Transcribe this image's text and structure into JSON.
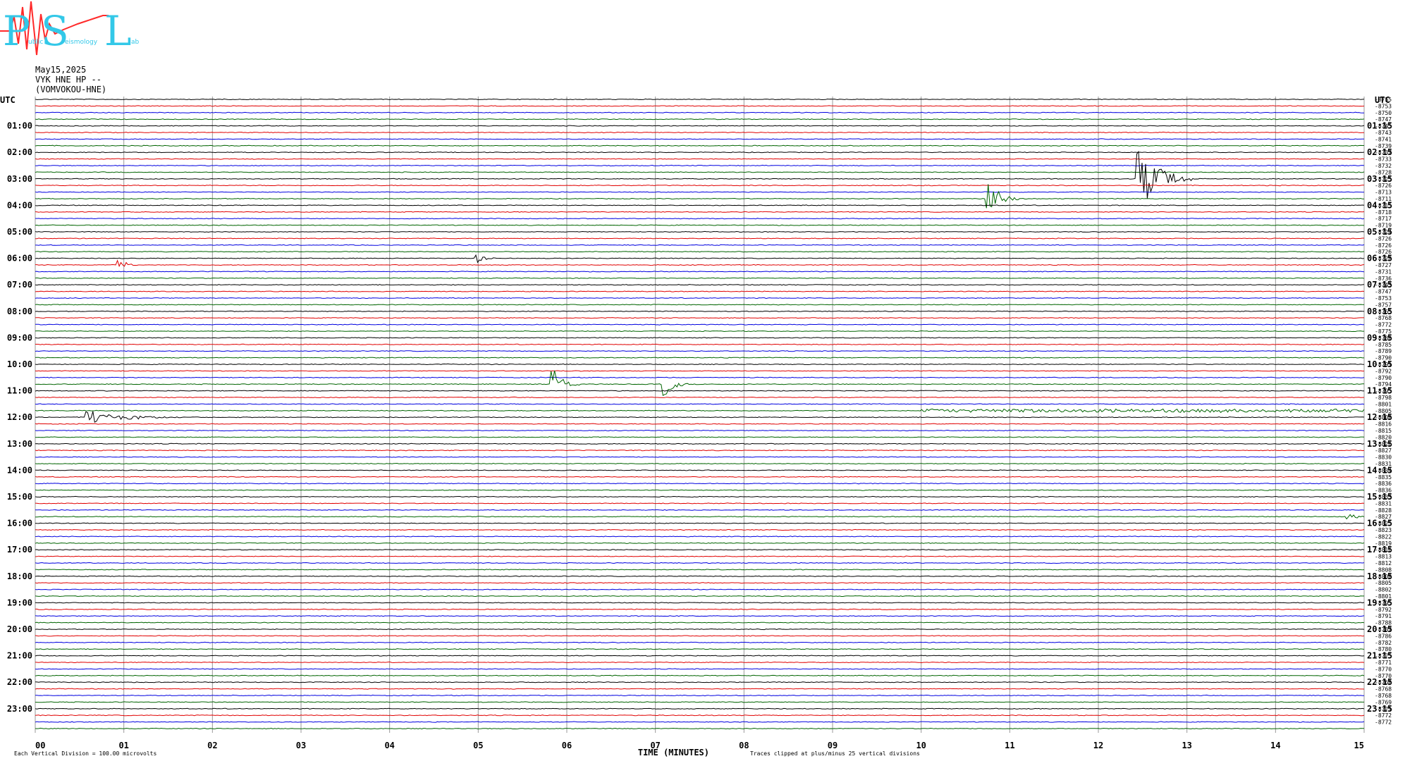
{
  "logo": {
    "letters": [
      "P",
      "S",
      "L"
    ],
    "words": [
      "ublic",
      "eismology",
      "ab"
    ],
    "colors": {
      "main": "#33c8e8",
      "wave": "#ff2a2a"
    }
  },
  "header": {
    "date": "May15,2025",
    "channel": "VYK HNE HP --",
    "station": "(VOMVOKOU-HNE)"
  },
  "chart_data": {
    "type": "line",
    "title": "",
    "xlabel": "TIME (MINUTES)",
    "x_ticks": [
      "00",
      "01",
      "02",
      "03",
      "04",
      "05",
      "06",
      "07",
      "08",
      "09",
      "10",
      "11",
      "12",
      "13",
      "14",
      "15"
    ],
    "xlim": [
      0,
      15
    ],
    "left_axis_label": "UTC",
    "right_axis_label": "UTC",
    "left_hour_labels": [
      "01:00",
      "02:00",
      "03:00",
      "04:00",
      "05:00",
      "06:00",
      "07:00",
      "08:00",
      "09:00",
      "10:00",
      "11:00",
      "12:00",
      "13:00",
      "14:00",
      "15:00",
      "16:00",
      "17:00",
      "18:00",
      "19:00",
      "20:00",
      "21:00",
      "22:00",
      "23:00"
    ],
    "right_hour_labels": [
      "01:15",
      "02:15",
      "03:15",
      "04:15",
      "05:15",
      "06:15",
      "07:15",
      "08:15",
      "09:15",
      "10:15",
      "11:15",
      "12:15",
      "13:15",
      "14:15",
      "15:15",
      "16:15",
      "17:15",
      "18:15",
      "19:15",
      "20:15",
      "21:15",
      "22:15",
      "23:15"
    ],
    "trace_colors": [
      "#000000",
      "#e00000",
      "#0000e0",
      "#006400"
    ],
    "trace_count": 96,
    "trace_offsets": [
      "-8755",
      "-8753",
      "-8750",
      "-8747",
      "-8745",
      "-8743",
      "-8741",
      "-8739",
      "-8737",
      "-8733",
      "-8732",
      "-8728",
      "-8725",
      "-8726",
      "-8713",
      "-8711",
      "-8715",
      "-8718",
      "-8717",
      "-8719",
      "-8724",
      "-8726",
      "-8726",
      "-8726",
      "-8728",
      "-8727",
      "-8731",
      "-8736",
      "-8743",
      "-8747",
      "-8753",
      "-8757",
      "-8765",
      "-8768",
      "-8772",
      "-8775",
      "-8780",
      "-8785",
      "-8789",
      "-8790",
      "-8791",
      "-8792",
      "-8790",
      "-8794",
      "-8795",
      "-8798",
      "-8801",
      "-8805",
      "-8808",
      "-8816",
      "-8815",
      "-8820",
      "-8826",
      "-8827",
      "-8830",
      "-8831",
      "-8834",
      "-8835",
      "-8836",
      "-8836",
      "-8833",
      "-8831",
      "-8828",
      "-8827",
      "-8825",
      "-8823",
      "-8822",
      "-8819",
      "-8816",
      "-8813",
      "-8812",
      "-8808",
      "-8808",
      "-8805",
      "-8802",
      "-8801",
      "-8795",
      "-8792",
      "-8791",
      "-8788",
      "-8787",
      "-8786",
      "-8782",
      "-8780",
      "-8775",
      "-8771",
      "-8770",
      "-8770",
      "-8768",
      "-8768",
      "-8768",
      "-8769",
      "-8771",
      "-8772",
      "-8772"
    ],
    "events": [
      {
        "trace": 12,
        "minute": 12.45,
        "amplitude": 5.2,
        "duration": 0.6
      },
      {
        "trace": 15,
        "minute": 10.75,
        "amplitude": 3.2,
        "duration": 0.35
      },
      {
        "trace": 43,
        "minute": 5.85,
        "amplitude": 2.6,
        "duration": 0.3
      },
      {
        "trace": 43,
        "minute": 7.08,
        "amplitude": 2.4,
        "duration": 0.3
      },
      {
        "trace": 48,
        "minute": 0.6,
        "amplitude": 1.1,
        "duration": 1.0
      },
      {
        "trace": 24,
        "minute": 5.0,
        "amplitude": 0.7,
        "duration": 0.25
      },
      {
        "trace": 25,
        "minute": 0.95,
        "amplitude": 0.8,
        "duration": 0.25
      },
      {
        "trace": 63,
        "minute": 14.8,
        "amplitude": 0.6,
        "duration": 0.4
      }
    ],
    "noisy_segments": [
      {
        "trace": 47,
        "from": 10.0,
        "to": 15.0,
        "amplitude": 0.9
      }
    ],
    "footer_left": "Each Vertical Division =  100.00 microvolts",
    "footer_right": "Traces clipped at plus/minus 25 vertical divisions"
  }
}
